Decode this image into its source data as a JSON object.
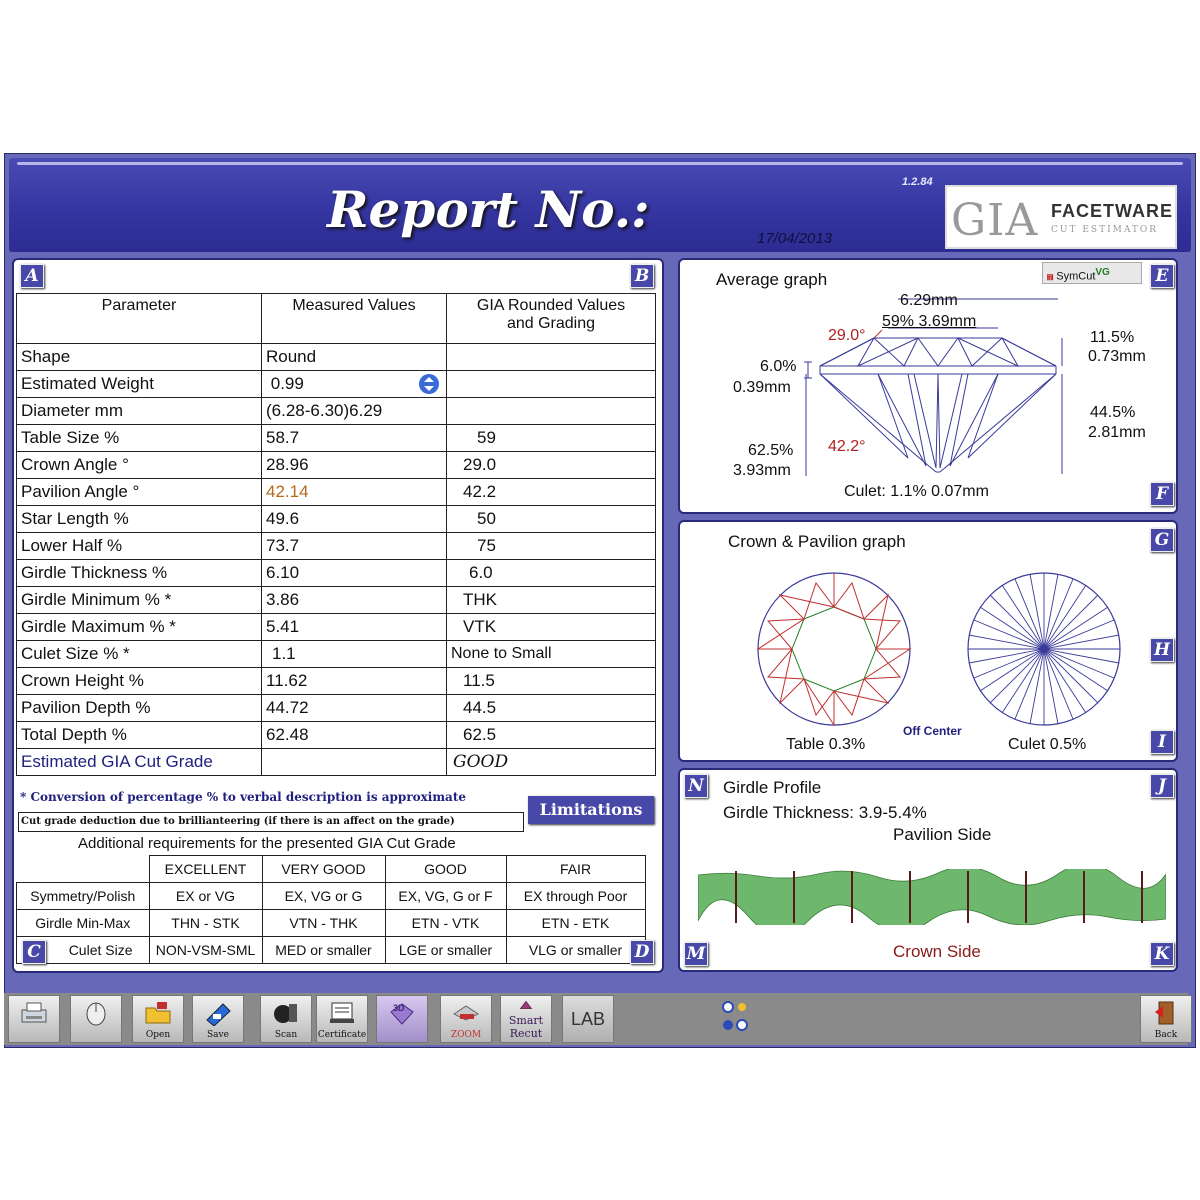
{
  "header": {
    "title": "Report No.:",
    "date": "17/04/2013",
    "version": "1.2.84",
    "logo_gia": "GIA",
    "logo_facetware": "FACETWARE",
    "logo_cut_estimator": "CUT ESTIMATOR"
  },
  "panel_letters": {
    "a": "A",
    "b": "B",
    "c": "C",
    "d": "D",
    "e": "E",
    "f": "F",
    "g": "G",
    "h": "H",
    "i": "I",
    "j": "J",
    "k": "K",
    "m": "M",
    "n": "N"
  },
  "params_table": {
    "headers": [
      "Parameter",
      "Measured Values",
      "GIA Rounded Values",
      "and Grading"
    ],
    "rows": [
      {
        "param": "Shape",
        "measured": "Round",
        "graded": ""
      },
      {
        "param": "Estimated Weight",
        "measured": "0.99",
        "graded": ""
      },
      {
        "param": "Diameter  mm",
        "measured": "(6.28-6.30)6.29",
        "graded": ""
      },
      {
        "param": "Table Size  %",
        "measured": "58.7",
        "graded": "59"
      },
      {
        "param": "Crown Angle  °",
        "measured": "28.96",
        "graded": "29.0"
      },
      {
        "param": "Pavilion Angle  °",
        "measured": "42.14",
        "graded": "42.2"
      },
      {
        "param": "Star Length  %",
        "measured": "49.6",
        "graded": "50"
      },
      {
        "param": "Lower Half  %",
        "measured": "73.7",
        "graded": "75"
      },
      {
        "param": "Girdle Thickness  %",
        "measured": "6.10",
        "graded": "6.0"
      },
      {
        "param": "Girdle Minimum  % *",
        "measured": "3.86",
        "graded": "THK"
      },
      {
        "param": "Girdle Maximum  % *",
        "measured": "5.41",
        "graded": "VTK"
      },
      {
        "param": "Culet Size  % *",
        "measured": "1.1",
        "graded": "None to Small"
      },
      {
        "param": "Crown Height  %",
        "measured": "11.62",
        "graded": "11.5"
      },
      {
        "param": "Pavilion Depth  %",
        "measured": "44.72",
        "graded": "44.5"
      },
      {
        "param": "Total Depth  %",
        "measured": "62.48",
        "graded": "62.5"
      },
      {
        "param": "Estimated GIA Cut Grade",
        "measured": "",
        "graded": "GOOD"
      }
    ],
    "note_conversion": "* Conversion of percentage % to verbal description is approximate",
    "limitations_button": "Limitations",
    "note_deduction": "Cut grade deduction due to brillianteering (if there is an affect on the grade)"
  },
  "requirements": {
    "title": "Additional requirements for the presented GIA Cut Grade",
    "columns": [
      "",
      "EXCELLENT",
      "VERY GOOD",
      "GOOD",
      "FAIR"
    ],
    "rows": [
      [
        "Symmetry/Polish",
        "EX or VG",
        "EX, VG or G",
        "EX, VG, G or F",
        "EX through Poor"
      ],
      [
        "Girdle Min-Max",
        "THN - STK",
        "VTN - THK",
        "ETN - VTK",
        "ETN - ETK"
      ],
      [
        "Culet Size",
        "NON-VSM-SML",
        "MED or smaller",
        "LGE or smaller",
        "VLG or smaller"
      ]
    ]
  },
  "average_graph": {
    "title": "Average graph",
    "syncut_label": "SymCut",
    "syncut_sup": "VG",
    "diameter": "6.29mm",
    "table": "59% 3.69mm",
    "crown_angle": "29.0°",
    "girdle_pct": "6.0%",
    "girdle_mm": "0.39mm",
    "crown_height_pct": "11.5%",
    "crown_height_mm": "0.73mm",
    "pavilion_depth_pct": "44.5%",
    "pavilion_depth_mm": "2.81mm",
    "total_depth_pct": "62.5%",
    "total_depth_mm": "3.93mm",
    "pavilion_angle": "42.2°",
    "culet": "Culet: 1.1% 0.07mm"
  },
  "crown_pavilion_graph": {
    "title": "Crown & Pavilion graph",
    "table_offset": "Table 0.3%",
    "off_center": "Off Center",
    "culet_offset": "Culet 0.5%"
  },
  "girdle_profile": {
    "title": "Girdle Profile",
    "thickness": "Girdle Thickness: 3.9-5.4%",
    "pavilion_side": "Pavilion Side",
    "crown_side": "Crown Side"
  },
  "toolbar": {
    "buttons": [
      {
        "label": "",
        "icon": "printer-icon"
      },
      {
        "label": "",
        "icon": "mouse-icon"
      },
      {
        "label": "Open",
        "icon": "open-folder-icon"
      },
      {
        "label": "Save",
        "icon": "save-disk-icon"
      },
      {
        "label": "Scan",
        "icon": "scanner-icon"
      },
      {
        "label": "Certificate",
        "icon": "certificate-icon"
      },
      {
        "label": "",
        "icon": "3d-view-icon"
      },
      {
        "label": "ZOOM",
        "icon": "zoom-icon"
      },
      {
        "label": "Smart Recut",
        "icon": "smart-recut-icon"
      },
      {
        "label": "LAB",
        "icon": "lab-icon"
      },
      {
        "label": "",
        "icon": "settings-icon"
      },
      {
        "label": "Back",
        "icon": "back-door-icon"
      }
    ]
  },
  "colors": {
    "frame": "#6868b8",
    "header": "#3434a0",
    "accent_letter": "#4848a8",
    "crown_lines": "#c03030",
    "pavilion_lines": "#3a3a9a",
    "girdle_fill": "#6db86d"
  }
}
